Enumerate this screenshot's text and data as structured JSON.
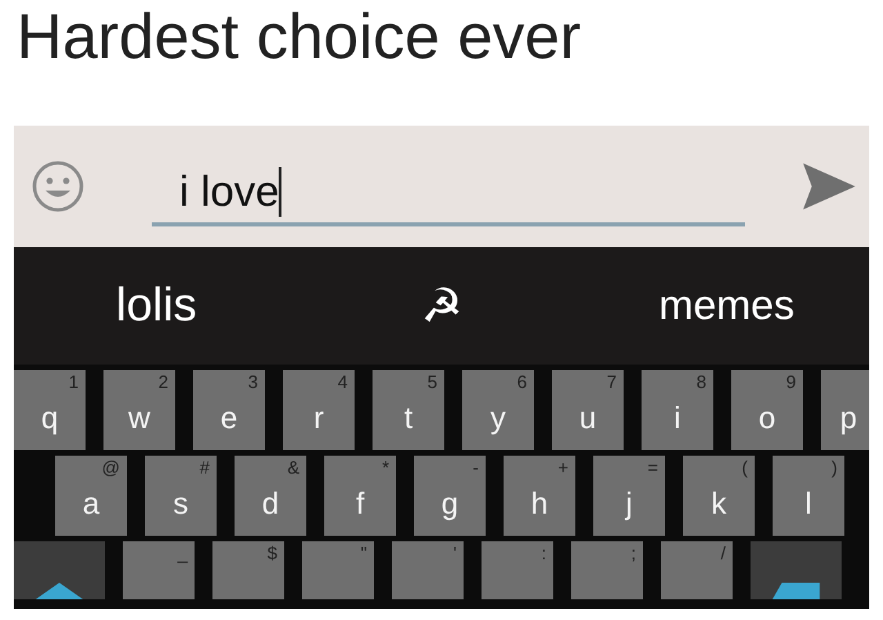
{
  "caption": "Hardest choice ever",
  "compose": {
    "value": "i love"
  },
  "suggestions": [
    {
      "text": "lolis"
    },
    {
      "text": "☭"
    },
    {
      "text": "memes"
    }
  ],
  "keyboard": {
    "rows": [
      [
        {
          "kind": "letter",
          "label": "q",
          "hint": "1"
        },
        {
          "kind": "letter",
          "label": "w",
          "hint": "2"
        },
        {
          "kind": "letter",
          "label": "e",
          "hint": "3"
        },
        {
          "kind": "letter",
          "label": "r",
          "hint": "4"
        },
        {
          "kind": "letter",
          "label": "t",
          "hint": "5"
        },
        {
          "kind": "letter",
          "label": "y",
          "hint": "6"
        },
        {
          "kind": "letter",
          "label": "u",
          "hint": "7"
        },
        {
          "kind": "letter",
          "label": "i",
          "hint": "8"
        },
        {
          "kind": "letter",
          "label": "o",
          "hint": "9"
        },
        {
          "kind": "letter",
          "label": "p"
        }
      ],
      [
        {
          "kind": "letter",
          "label": "a",
          "hint": "@"
        },
        {
          "kind": "letter",
          "label": "s",
          "hint": "#"
        },
        {
          "kind": "letter",
          "label": "d",
          "hint": "&"
        },
        {
          "kind": "letter",
          "label": "f",
          "hint": "*"
        },
        {
          "kind": "letter",
          "label": "g",
          "hint": "-"
        },
        {
          "kind": "letter",
          "label": "h",
          "hint": "+"
        },
        {
          "kind": "letter",
          "label": "j",
          "hint": "="
        },
        {
          "kind": "letter",
          "label": "k",
          "hint": "("
        },
        {
          "kind": "letter",
          "label": "l",
          "hint": ")"
        }
      ],
      [
        {
          "kind": "shift"
        },
        {
          "kind": "letter",
          "hint": "_"
        },
        {
          "kind": "letter",
          "hint": "$"
        },
        {
          "kind": "letter",
          "hint": "\""
        },
        {
          "kind": "letter",
          "hint": "'"
        },
        {
          "kind": "letter",
          "hint": ":"
        },
        {
          "kind": "letter",
          "hint": ";"
        },
        {
          "kind": "letter",
          "hint": "/"
        },
        {
          "kind": "delete"
        }
      ]
    ]
  }
}
